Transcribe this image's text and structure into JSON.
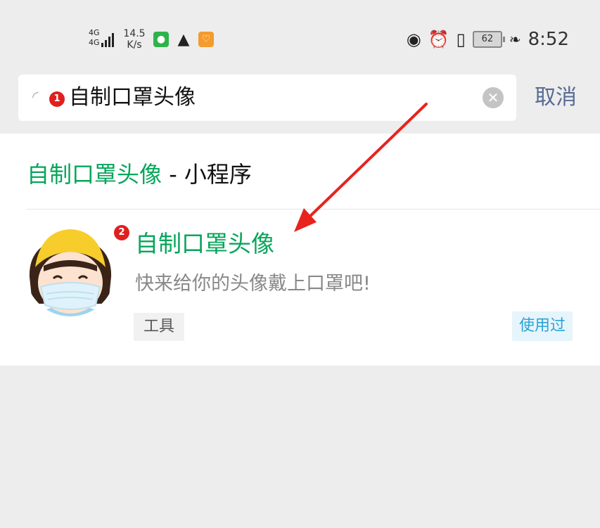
{
  "status_bar": {
    "network": "4G",
    "network_sub": "4G",
    "speed_value": "14.5",
    "speed_unit": "K/s",
    "battery": "62",
    "time": "8:52"
  },
  "search": {
    "query": "自制口罩头像",
    "cancel_label": "取消",
    "badge_number": "1"
  },
  "results": {
    "section_title_highlight": "自制口罩头像",
    "section_title_suffix": " - 小程序",
    "items": [
      {
        "name": "自制口罩头像",
        "description": "快来给你的头像戴上口罩吧!",
        "tag": "工具",
        "status": "使用过",
        "badge_number": "2"
      }
    ]
  },
  "colors": {
    "accent_green": "#07a55b",
    "link_blue": "#576b95",
    "badge_red": "#e01f1f",
    "arrow_red": "#e8231e"
  }
}
